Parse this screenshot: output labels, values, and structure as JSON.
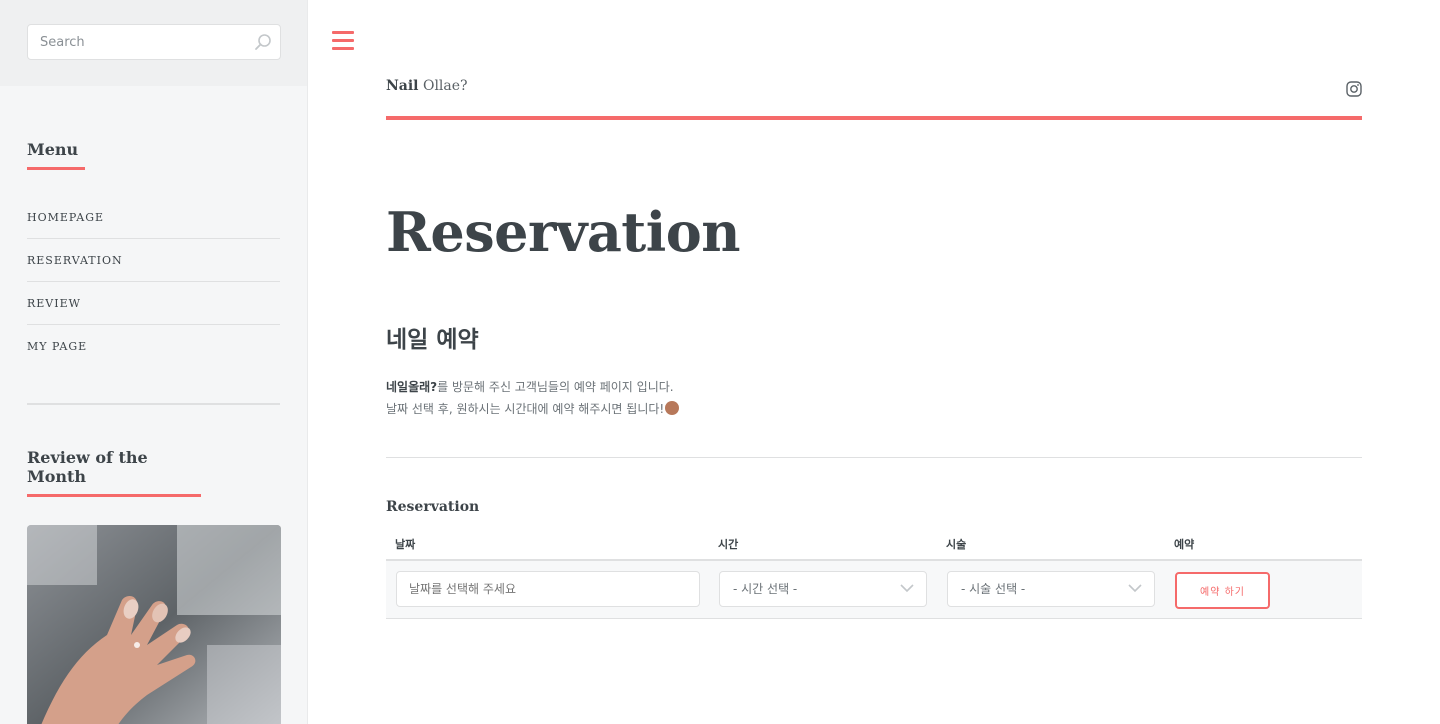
{
  "sidebar": {
    "search": {
      "placeholder": "Search"
    },
    "menu": {
      "title": "Menu",
      "items": [
        {
          "label": "HOMEPAGE"
        },
        {
          "label": "RESERVATION"
        },
        {
          "label": "REVIEW"
        },
        {
          "label": "MY PAGE"
        }
      ]
    },
    "review": {
      "title": "Review of the Month"
    }
  },
  "header": {
    "brand_bold": "Nail",
    "brand_rest": "Ollae?"
  },
  "main": {
    "title": "Reservation",
    "subtitle": "네일 예약",
    "intro": {
      "line1_bold": "네일올래?",
      "line1_rest": "를 방문해 주신 고객님들의 예약 페이지 입니다.",
      "line2": "날짜 선택 후, 원하시는 시간대에 예약 해주시면 됩니다!"
    },
    "form": {
      "title": "Reservation",
      "columns": [
        "날짜",
        "시간",
        "시술",
        "예약"
      ],
      "date_placeholder": "날짜를 선택해 주세요",
      "time_select": "- 시간 선택 -",
      "service_select": "- 시술 선택 -",
      "submit_label": "예약 하기"
    }
  },
  "colors": {
    "accent": "#f56a6a",
    "text": "#3d4449",
    "sidebar_bg": "#f5f6f7"
  }
}
